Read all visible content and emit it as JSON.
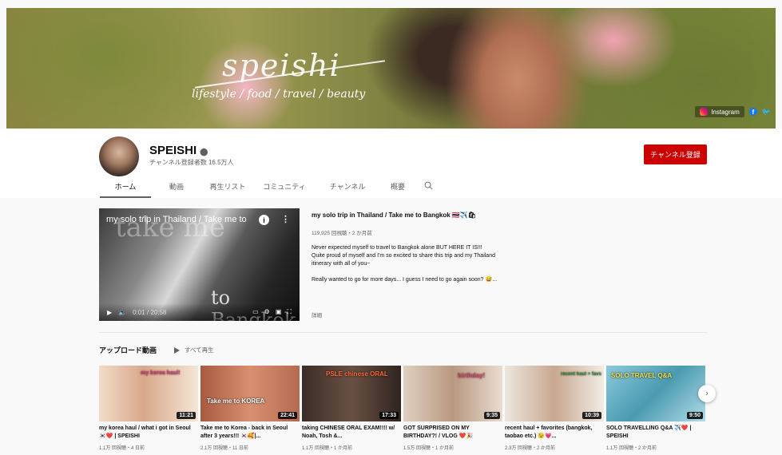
{
  "banner": {
    "logo_text": "speishi",
    "tagline": "lifestyle / food / travel / beauty",
    "instagram_label": "Instagram"
  },
  "channel": {
    "name": "SPEISHI",
    "subscribers": "チャンネル登録者数 16.5万人",
    "subscribe_label": "チャンネル登録"
  },
  "tabs": [
    "ホーム",
    "動画",
    "再生リスト",
    "コミュニティ",
    "チャンネル",
    "概要"
  ],
  "featured": {
    "overlay_title": "my solo trip in Thailand / Take me to",
    "bg_text": "take me",
    "bangkok_text": "to Bangkok",
    "time": "0:01 / 20:58",
    "title": "my solo trip in Thailand / Take me to Bangkok 🇹🇭✈️🛍",
    "stats": "119,925 回視聴・2 か月前",
    "description": "Never expected myself to travel to Bangkok alone BUT HERE IT IS!!!\nQuite proud of myself and I'm so excited to share this trip and my Thailand itinerary with all of you~\n\nReally wanted to go for more days... I guess I need to go again soon? 😅...",
    "more": "詳細"
  },
  "uploads": {
    "title": "アップロード動画",
    "play_all": "すべて再生",
    "videos": [
      {
        "title": "my korea haul / what i got in Seoul 🇰🇷❤️ | SPEISHI",
        "meta": "1.1万 回視聴・4 日前",
        "duration": "11:21",
        "tag": "my korea haul!",
        "color": "#e8c8a8"
      },
      {
        "title": "Take me to Korea - back in Seoul after 3 years!!! 🇰🇷🥰|...",
        "meta": "2.1万 回視聴・11 日前",
        "duration": "22:41",
        "tag": "Take me to KOREA",
        "color": "#c8785a"
      },
      {
        "title": "taking CHINESE ORAL EXAM!!!! w/ Noah, Tosh &...",
        "meta": "1.1万 回視聴・1 か月前",
        "duration": "17:33",
        "tag": "PSLE chinese ORAL",
        "color": "#5a4438"
      },
      {
        "title": "GOT SURPRISED ON MY BIRTHDAY?! / VLOG ❤️🎉",
        "meta": "1.5万 回視聴・1 か月前",
        "duration": "9:35",
        "tag": "birthday!",
        "color": "#d8c8b8"
      },
      {
        "title": "recent haul + favorites (bangkok, taobao etc.) 😉💗...",
        "meta": "2.3万 回視聴・2 か月前",
        "duration": "10:39",
        "tag": "recent haul + favs",
        "color": "#e8e0d8"
      },
      {
        "title": "SOLO TRAVELLING Q&A ✈️❤️ | SPEISHI",
        "meta": "1.1万 回視聴・2 か月前",
        "duration": "9:50",
        "tag": "SOLO TRAVEL Q&A",
        "color": "#7ab8c8"
      }
    ]
  }
}
